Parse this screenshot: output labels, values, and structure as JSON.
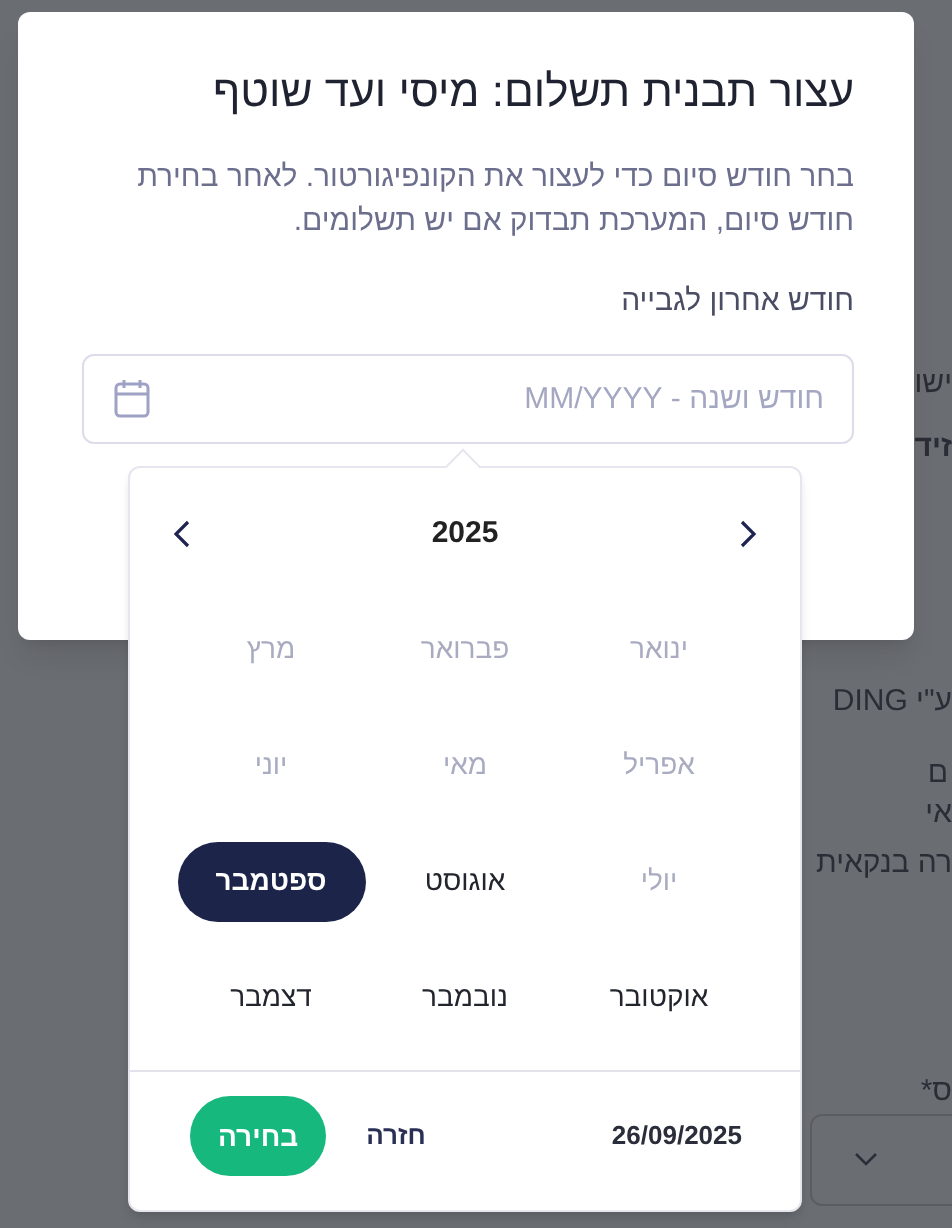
{
  "background": {
    "texts": [
      {
        "text": "ישו",
        "kind": "plain"
      },
      {
        "text": "זיד",
        "kind": "bold"
      },
      {
        "text": "ע\"י DING",
        "kind": "plain"
      },
      {
        "text": "ם",
        "kind": "plain"
      },
      {
        "text": "אי",
        "kind": "plain"
      },
      {
        "text": "רה בנקאית",
        "kind": "plain"
      },
      {
        "text": "ס*",
        "kind": "plain"
      }
    ]
  },
  "dialog": {
    "title": "עצור תבנית תשלום: מיסי ועד שוטף",
    "description": "בחר חודש סיום כדי לעצור את הקונפיגורטור. לאחר בחירת חודש סיום, המערכת תבדוק אם יש תשלומים.",
    "field": {
      "label": "חודש אחרון לגבייה",
      "placeholder": "חודש ושנה - MM/YYYY"
    }
  },
  "picker": {
    "year": "2025",
    "months": [
      {
        "label": "ינואר",
        "disabled": true,
        "selected": false
      },
      {
        "label": "פברואר",
        "disabled": true,
        "selected": false
      },
      {
        "label": "מרץ",
        "disabled": true,
        "selected": false
      },
      {
        "label": "אפריל",
        "disabled": true,
        "selected": false
      },
      {
        "label": "מאי",
        "disabled": true,
        "selected": false
      },
      {
        "label": "יוני",
        "disabled": true,
        "selected": false
      },
      {
        "label": "יולי",
        "disabled": true,
        "selected": false
      },
      {
        "label": "אוגוסט",
        "disabled": false,
        "selected": false
      },
      {
        "label": "ספטמבר",
        "disabled": false,
        "selected": true
      },
      {
        "label": "אוקטובר",
        "disabled": false,
        "selected": false
      },
      {
        "label": "נובמבר",
        "disabled": false,
        "selected": false
      },
      {
        "label": "דצמבר",
        "disabled": false,
        "selected": false
      }
    ],
    "date": "26/09/2025",
    "back": "חזרה",
    "select": "בחירה"
  }
}
